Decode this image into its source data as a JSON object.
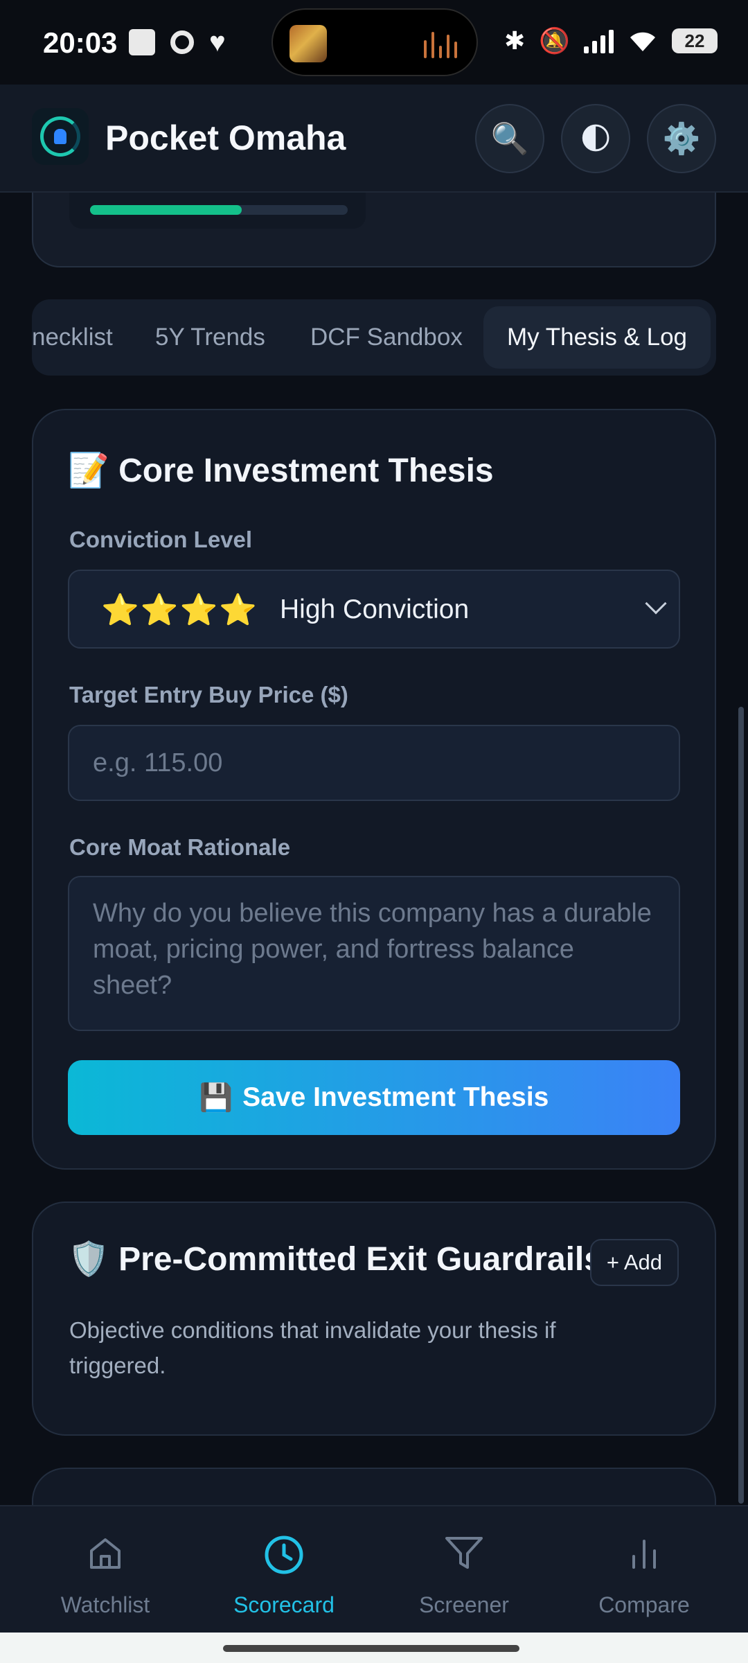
{
  "status": {
    "time": "20:03",
    "battery": "22"
  },
  "header": {
    "title": "Pocket Omaha",
    "search_icon": "🔍",
    "theme_icon": "🌓",
    "settings_icon": "⚙️"
  },
  "progress": {
    "fraction": 0.59,
    "color": "#14c08a"
  },
  "tabs": [
    {
      "label": "necklist",
      "active": false
    },
    {
      "label": "5Y Trends",
      "active": false
    },
    {
      "label": "DCF Sandbox",
      "active": false
    },
    {
      "label": "My Thesis & Log",
      "active": true
    }
  ],
  "thesis": {
    "icon": "📝",
    "title": "Core Investment Thesis",
    "conviction_label": "Conviction Level",
    "conviction_stars": "⭐⭐⭐⭐",
    "conviction_value": "High Conviction",
    "price_label": "Target Entry Buy Price ($)",
    "price_placeholder": "e.g. 115.00",
    "price_value": "",
    "moat_label": "Core Moat Rationale",
    "moat_placeholder": "Why do you believe this company has a durable moat, pricing power, and fortress balance sheet?",
    "moat_value": "",
    "save_icon": "💾",
    "save_label": "Save Investment Thesis"
  },
  "guardrails": {
    "icon": "🛡️",
    "title": "Pre-Committed Exit Guardrails",
    "add_label": "+ Add",
    "description": "Objective conditions that invalidate your thesis if triggered."
  },
  "nav": [
    {
      "label": "Watchlist",
      "icon": "home-icon",
      "active": false
    },
    {
      "label": "Scorecard",
      "icon": "clock-icon",
      "active": true
    },
    {
      "label": "Screener",
      "icon": "filter-icon",
      "active": false
    },
    {
      "label": "Compare",
      "icon": "bar-chart-icon",
      "active": false
    }
  ],
  "colors": {
    "accent": "#22c1e6",
    "background": "#0b0f17",
    "card": "#121926",
    "star": "#f5c518"
  }
}
